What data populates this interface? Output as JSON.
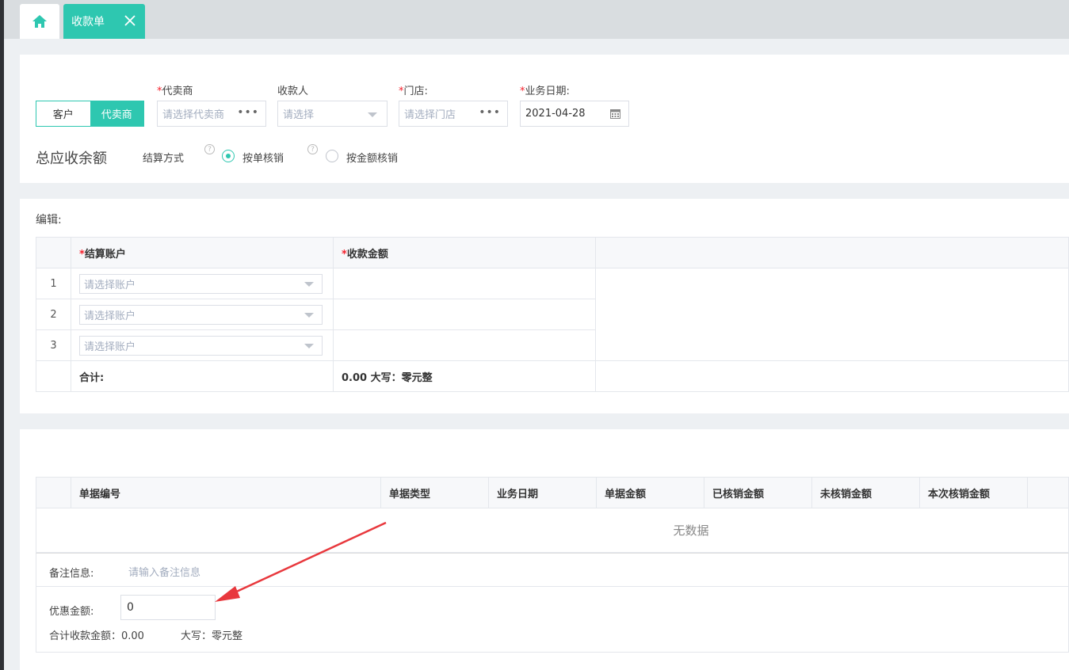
{
  "tabs": {
    "home_icon": "home-icon",
    "active_label": "收款单",
    "close_icon": "close-icon"
  },
  "form": {
    "toggle": [
      "客户",
      "代卖商"
    ],
    "required_mark": "*",
    "agent_label": "代卖商",
    "agent_placeholder": "请选择代卖商",
    "payee_label": "收款人",
    "payee_placeholder": "请选择",
    "store_label": "门店:",
    "store_placeholder": "请选择门店",
    "date_label": "业务日期:",
    "date_value": "2021-04-28",
    "more_icon": "•••",
    "total_receivable_label": "总应收余额",
    "settle_label": "结算方式",
    "help_icon": "?",
    "settle_options": [
      "按单核销",
      "按金额核销"
    ]
  },
  "edit": {
    "title": "编辑:",
    "col_account": "结算账户",
    "col_amount": "收款金额",
    "rows": [
      "1",
      "2",
      "3"
    ],
    "account_placeholder": "请选择账户",
    "sum_label": "合计:",
    "sum_value": "0.00 大写：零元整"
  },
  "docs": {
    "columns": [
      "单据编号",
      "单据类型",
      "业务日期",
      "单据金额",
      "已核销金额",
      "未核销金额",
      "本次核销金额"
    ],
    "empty_text": "无数据",
    "remark_label": "备注信息:",
    "remark_placeholder": "请输入备注信息",
    "discount_label": "优惠金额:",
    "discount_value": "0",
    "total_label": "合计收款金额：0.00",
    "capital_label": "大写：零元整"
  },
  "colors": {
    "accent": "#2ec7b0",
    "required": "#f5222d",
    "arrow": "#e8383d"
  }
}
